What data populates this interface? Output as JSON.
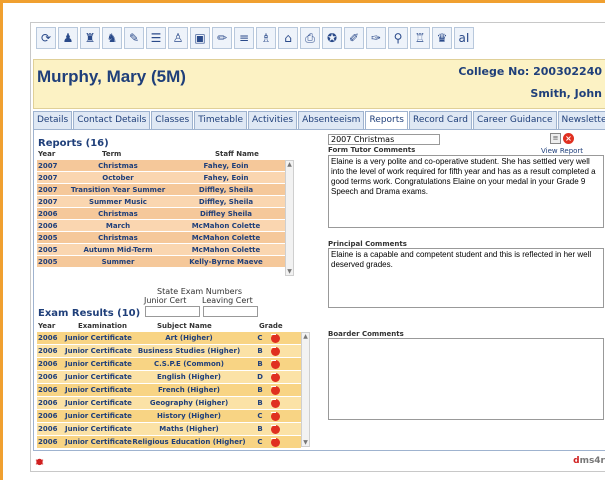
{
  "toolbar": {
    "buttons": [
      {
        "icon": "refresh-icon",
        "glyph": "⟳"
      },
      {
        "icon": "person-icon",
        "glyph": "♟"
      },
      {
        "icon": "people-icon",
        "glyph": "♜"
      },
      {
        "icon": "users-group-icon",
        "glyph": "♞"
      },
      {
        "icon": "class-icon",
        "glyph": "✎"
      },
      {
        "icon": "timetable-icon",
        "glyph": "☰"
      },
      {
        "icon": "teacher-icon",
        "glyph": "♙"
      },
      {
        "icon": "bus-icon",
        "glyph": "▣"
      },
      {
        "icon": "pen-icon",
        "glyph": "✏"
      },
      {
        "icon": "list-icon",
        "glyph": "≡"
      },
      {
        "icon": "students-icon",
        "glyph": "♗"
      },
      {
        "icon": "home-icon",
        "glyph": "⌂"
      },
      {
        "icon": "print-icon",
        "glyph": "⎙"
      },
      {
        "icon": "award-icon",
        "glyph": "✪"
      },
      {
        "icon": "edit-icon",
        "glyph": "✐"
      },
      {
        "icon": "pin-icon",
        "glyph": "✑"
      },
      {
        "icon": "search-icon",
        "glyph": "⚲"
      },
      {
        "icon": "user-search-icon",
        "glyph": "♖"
      },
      {
        "icon": "user-group-icon",
        "glyph": "♛"
      },
      {
        "icon": "alphabet-icon",
        "glyph": "aI"
      }
    ]
  },
  "header": {
    "student_name": "Murphy, Mary (5M)",
    "college_no": "College No: 200302240",
    "tutor": "Smith, John"
  },
  "tabs": [
    {
      "label": "Details",
      "active": false
    },
    {
      "label": "Contact Details",
      "active": false
    },
    {
      "label": "Classes",
      "active": false
    },
    {
      "label": "Timetable",
      "active": false
    },
    {
      "label": "Activities",
      "active": false
    },
    {
      "label": "Absenteeism",
      "active": false
    },
    {
      "label": "Reports",
      "active": true
    },
    {
      "label": "Record Card",
      "active": false
    },
    {
      "label": "Career Guidance",
      "active": false
    },
    {
      "label": "Newsletter",
      "active": false
    }
  ],
  "reports": {
    "title": "Reports (16)",
    "columns": {
      "year": "Year",
      "term": "Term",
      "staff": "Staff Name"
    },
    "rows": [
      {
        "year": "2007",
        "term": "Christmas",
        "staff": "Fahey, Eoin"
      },
      {
        "year": "2007",
        "term": "October",
        "staff": "Fahey, Eoin"
      },
      {
        "year": "2007",
        "term": "Transition Year Summer",
        "staff": "Diffley, Sheila"
      },
      {
        "year": "2007",
        "term": "Summer Music",
        "staff": "Diffley, Sheila"
      },
      {
        "year": "2006",
        "term": "Christmas",
        "staff": "Diffley Sheila"
      },
      {
        "year": "2006",
        "term": "March",
        "staff": "McMahon Colette"
      },
      {
        "year": "2005",
        "term": "Christmas",
        "staff": "McMahon Colette"
      },
      {
        "year": "2005",
        "term": "Autumn Mid-Term",
        "staff": "McMahon Colette"
      },
      {
        "year": "2005",
        "term": "Summer",
        "staff": "Kelly-Byrne Maeve"
      }
    ]
  },
  "state_exam": {
    "title": "State Exam Numbers",
    "junior_label": "Junior Cert",
    "leaving_label": "Leaving Cert",
    "junior_value": "",
    "leaving_value": ""
  },
  "exams": {
    "title": "Exam Results (10)",
    "columns": {
      "year": "Year",
      "exam": "Examination",
      "subject": "Subject Name",
      "grade": "Grade"
    },
    "rows": [
      {
        "year": "2006",
        "exam": "Junior Certificate",
        "subject": "Art (Higher)",
        "grade": "C"
      },
      {
        "year": "2006",
        "exam": "Junior Certificate",
        "subject": "Business Studies (Higher)",
        "grade": "B"
      },
      {
        "year": "2006",
        "exam": "Junior Certificate",
        "subject": "C.S.P.E (Common)",
        "grade": "B"
      },
      {
        "year": "2006",
        "exam": "Junior Certificate",
        "subject": "English (Higher)",
        "grade": "D"
      },
      {
        "year": "2006",
        "exam": "Junior Certificate",
        "subject": "French (Higher)",
        "grade": "B"
      },
      {
        "year": "2006",
        "exam": "Junior Certificate",
        "subject": "Geography (Higher)",
        "grade": "B"
      },
      {
        "year": "2006",
        "exam": "Junior Certificate",
        "subject": "History (Higher)",
        "grade": "C"
      },
      {
        "year": "2006",
        "exam": "Junior Certificate",
        "subject": "Maths (Higher)",
        "grade": "B"
      },
      {
        "year": "2006",
        "exam": "Junior Certificate",
        "subject": "Religious Education (Higher)",
        "grade": "C"
      }
    ]
  },
  "report_detail": {
    "selected_report": "2007 Christmas",
    "view_report": "View Report",
    "form_tutor_label": "Form Tutor Comments",
    "form_tutor_text": "Elaine is a very polite and co-operative student.  She has settled very well into the level of work required for fifth year and has as a result completed a good terms work.  Congratulations Elaine on your medal in your Grade 9 Speech and Drama exams.",
    "principal_label": "Principal Comments",
    "principal_text": " Elaine is a capable and competent student and this is reflected in her well deserved grades.",
    "boarder_label": "Boarder Comments",
    "boarder_text": ""
  },
  "footer": {
    "logo_prefix": "d",
    "logo_rest": "ms4r"
  },
  "colors": {
    "accent_orange": "#f0a030",
    "header_bg": "#fcf2c4",
    "title_blue": "#1f3f7a",
    "report_row": "#f5c89a",
    "exam_row": "#f8d484",
    "delete_red": "#e03020"
  }
}
